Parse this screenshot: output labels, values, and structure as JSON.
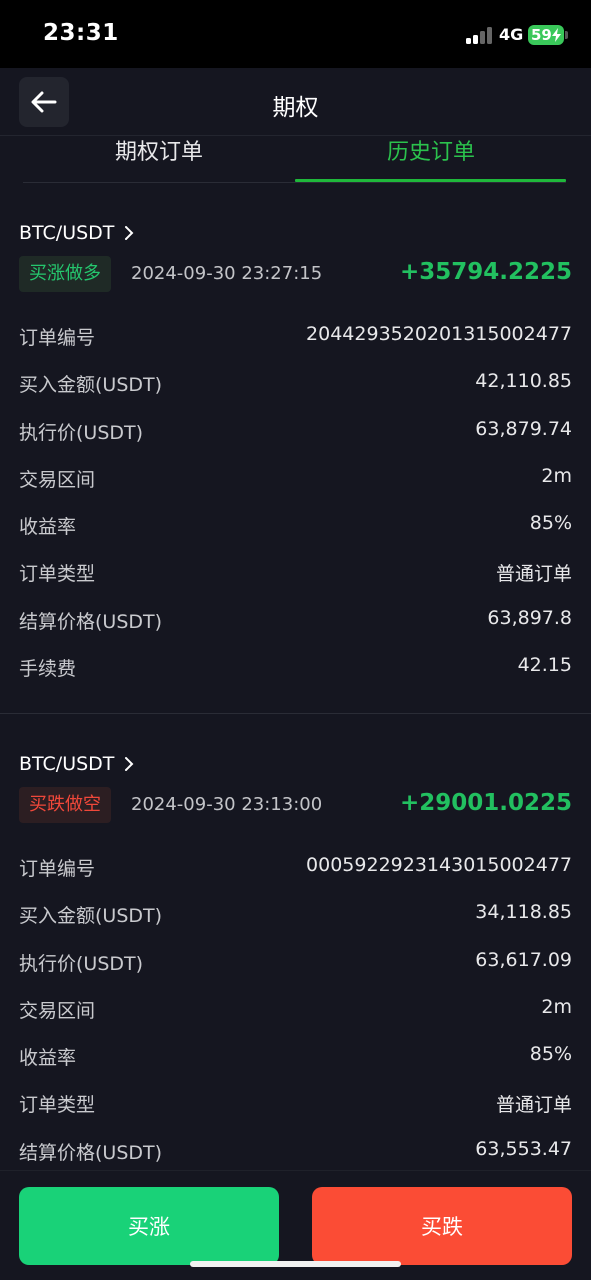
{
  "status_bar": {
    "time": "23:31",
    "network": "4G",
    "battery": "59"
  },
  "header": {
    "title": "期权"
  },
  "tabs": [
    {
      "label": "期权订单",
      "active": false
    },
    {
      "label": "历史订单",
      "active": true
    }
  ],
  "colors": {
    "accent_green": "#1fb83b",
    "profit_green": "#22c060",
    "up_button": "#19d278",
    "down_button": "#fb4c35",
    "badge_down_text": "#f0483a"
  },
  "orders": [
    {
      "pair": "BTC/USDT",
      "direction": "买涨做多",
      "direction_type": "up",
      "time": "2024-09-30 23:27:15",
      "profit": "+35794.2225",
      "fields": [
        {
          "label": "订单编号",
          "value": "2044293520201315002477"
        },
        {
          "label": "买入金额(USDT)",
          "value": "42,110.85"
        },
        {
          "label": "执行价(USDT)",
          "value": "63,879.74"
        },
        {
          "label": "交易区间",
          "value": "2m"
        },
        {
          "label": "收益率",
          "value": "85%"
        },
        {
          "label": "订单类型",
          "value": "普通订单"
        },
        {
          "label": "结算价格(USDT)",
          "value": "63,897.8"
        },
        {
          "label": "手续费",
          "value": "42.15"
        }
      ]
    },
    {
      "pair": "BTC/USDT",
      "direction": "买跌做空",
      "direction_type": "down",
      "time": "2024-09-30 23:13:00",
      "profit": "+29001.0225",
      "fields": [
        {
          "label": "订单编号",
          "value": "0005922923143015002477"
        },
        {
          "label": "买入金额(USDT)",
          "value": "34,118.85"
        },
        {
          "label": "执行价(USDT)",
          "value": "63,617.09"
        },
        {
          "label": "交易区间",
          "value": "2m"
        },
        {
          "label": "收益率",
          "value": "85%"
        },
        {
          "label": "订单类型",
          "value": "普通订单"
        },
        {
          "label": "结算价格(USDT)",
          "value": "63,553.47"
        }
      ]
    }
  ],
  "actions": {
    "buy_up": "买涨",
    "buy_down": "买跌"
  },
  "icons": {
    "back": "arrow-left-icon",
    "chevron": "chevron-right-icon"
  }
}
